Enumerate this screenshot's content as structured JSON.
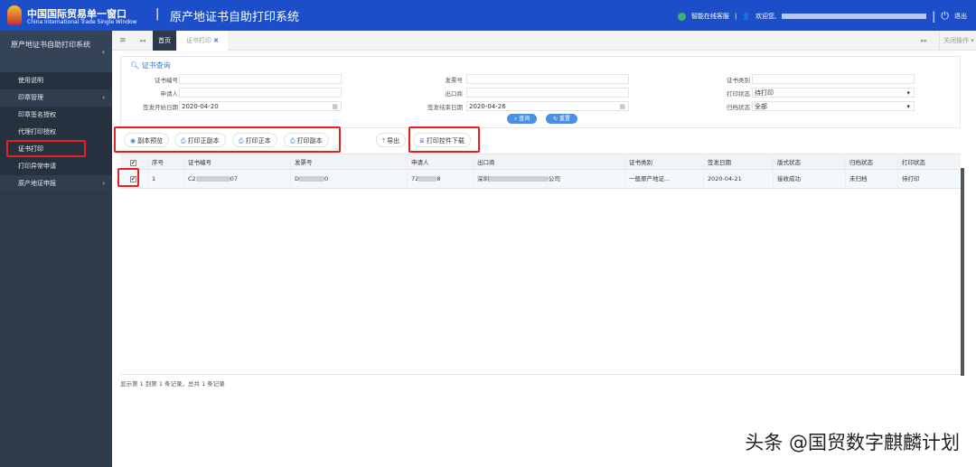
{
  "header": {
    "brand_cn": "中国国际贸易单一窗口",
    "brand_en": "China International Trade Single Window",
    "separator": "|",
    "system_title": "原产地证书自助打印系统",
    "service": "智能在线客服",
    "welcome": "欢迎您,",
    "logout": "退出",
    "brand_color": "#1d4ec9"
  },
  "sidebar": {
    "title": "原产地证书自助打印系统",
    "items": [
      {
        "label": "使用说明"
      },
      {
        "label": "印章管理",
        "chevron": "‹"
      },
      {
        "label": "印章签名授权"
      },
      {
        "label": "代理打印授权"
      },
      {
        "label": "证书打印",
        "active": true
      },
      {
        "label": "打印异常申请"
      },
      {
        "label": "原产地证申报",
        "chevron": "‹"
      }
    ]
  },
  "tabs": {
    "menu_icon": "≡",
    "back_icon": "◂◂",
    "home": "首页",
    "current": "证书打印",
    "forward_icon": "▸▸",
    "close_ops": "关闭操作"
  },
  "query": {
    "title": "证书查询",
    "fields": {
      "cert_no": {
        "label": "证书编号",
        "value": ""
      },
      "invoice_no": {
        "label": "发票号",
        "value": ""
      },
      "cert_type": {
        "label": "证书类别",
        "value": ""
      },
      "applicant": {
        "label": "申请人",
        "value": ""
      },
      "exporter": {
        "label": "出口商",
        "value": ""
      },
      "print_status": {
        "label": "打印状态",
        "value": "待打印"
      },
      "start_date": {
        "label": "签发开始日期",
        "value": "2020-04-20"
      },
      "end_date": {
        "label": "签发结束日期",
        "value": "2020-04-26"
      },
      "archive_status": {
        "label": "归档状态",
        "value": "全部"
      }
    },
    "search": "查询",
    "reset": "重置"
  },
  "toolbar": {
    "preview": "副本预览",
    "print_both": "打印正副本",
    "print_original": "打印正本",
    "print_copy": "打印副本",
    "export": "导出",
    "download": "打印控件下载"
  },
  "table": {
    "headers": [
      "序号",
      "证书编号",
      "发票号",
      "申请人",
      "出口商",
      "证书类别",
      "签发日期",
      "版式状态",
      "归档状态",
      "打印状态"
    ],
    "rows": [
      {
        "no": "1",
        "cert_no_a": "C2",
        "cert_no_b": "07",
        "invoice_a": "D",
        "invoice_b": "0",
        "applicant_a": "72",
        "applicant_b": "8",
        "exporter_a": "深圳",
        "exporter_b": "公司",
        "cert_type": "一般原产地证...",
        "date": "2020-04-21",
        "format_status": "接收成功",
        "archive_status": "未归档",
        "print_status": "待打印",
        "checked": true
      }
    ]
  },
  "footer": {
    "summary": "显示第 1 到第 1 条记录，总共 1 条记录"
  },
  "watermark": "头条 @国贸数字麒麟计划"
}
